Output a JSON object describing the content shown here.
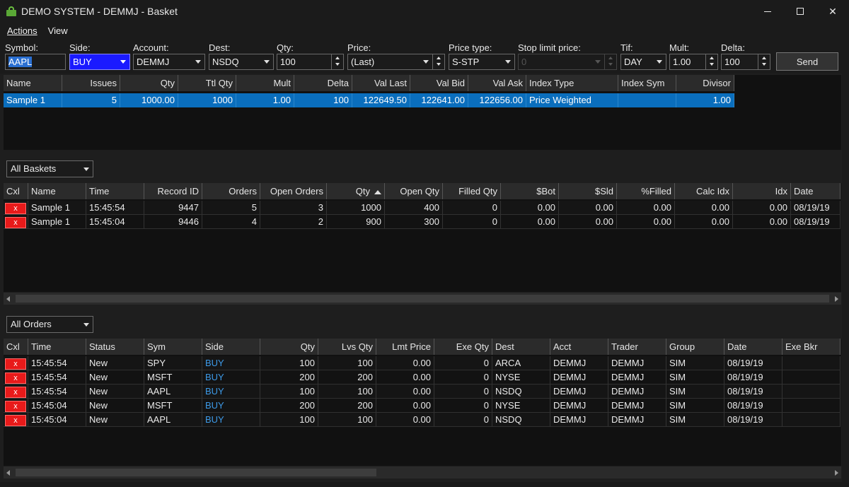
{
  "window": {
    "title": "DEMO SYSTEM - DEMMJ - Basket",
    "icon": "basket-icon",
    "minimize": "—",
    "maximize": "☐",
    "close": "✕"
  },
  "menu": {
    "actions": "Actions",
    "view": "View"
  },
  "entry": {
    "symbol": {
      "label": "Symbol:",
      "value": "AAPL"
    },
    "side": {
      "label": "Side:",
      "value": "BUY"
    },
    "account": {
      "label": "Account:",
      "value": "DEMMJ"
    },
    "dest": {
      "label": "Dest:",
      "value": "NSDQ"
    },
    "qty": {
      "label": "Qty:",
      "value": "100"
    },
    "price": {
      "label": "Price:",
      "value": "(Last)"
    },
    "price_type": {
      "label": "Price type:",
      "value": "S-STP"
    },
    "stop_limit": {
      "label": "Stop limit price:",
      "value": "0"
    },
    "tif": {
      "label": "Tif:",
      "value": "DAY"
    },
    "mult": {
      "label": "Mult:",
      "value": "1.00"
    },
    "delta": {
      "label": "Delta:",
      "value": "100"
    },
    "send": "Send"
  },
  "basket_grid": {
    "columns": [
      "Name",
      "Issues",
      "Qty",
      "Ttl Qty",
      "Mult",
      "Delta",
      "Val Last",
      "Val Bid",
      "Val Ask",
      "Index Type",
      "Index Sym",
      "Divisor"
    ],
    "rows": [
      [
        "Sample 1",
        "5",
        "1000.00",
        "1000",
        "1.00",
        "100",
        "122649.50",
        "122641.00",
        "122656.00",
        "Price Weighted",
        "",
        "1.00"
      ]
    ]
  },
  "records": {
    "filter": "All Baskets",
    "columns": [
      "Cxl",
      "Name",
      "Time",
      "Record ID",
      "Orders",
      "Open Orders",
      "Qty",
      "Open Qty",
      "Filled Qty",
      "$Bot",
      "$Sld",
      "%Filled",
      "Calc Idx",
      "Idx",
      "Date"
    ],
    "cancel_label": "x",
    "rows": [
      [
        "Sample 1",
        "15:45:54",
        "9447",
        "5",
        "3",
        "1000",
        "400",
        "0",
        "0.00",
        "0.00",
        "0.00",
        "0.00",
        "0.00",
        "08/19/19"
      ],
      [
        "Sample 1",
        "15:45:04",
        "9446",
        "4",
        "2",
        "900",
        "300",
        "0",
        "0.00",
        "0.00",
        "0.00",
        "0.00",
        "0.00",
        "08/19/19"
      ]
    ]
  },
  "orders": {
    "filter": "All Orders",
    "columns": [
      "Cxl",
      "Time",
      "Status",
      "Sym",
      "Side",
      "Qty",
      "Lvs Qty",
      "Lmt Price",
      "Exe Qty",
      "Dest",
      "Acct",
      "Trader",
      "Group",
      "Date",
      "Exe Bkr"
    ],
    "cancel_label": "x",
    "rows": [
      [
        "15:45:54",
        "New",
        "SPY",
        "BUY",
        "100",
        "100",
        "0.00",
        "0",
        "ARCA",
        "DEMMJ",
        "DEMMJ",
        "SIM",
        "08/19/19",
        ""
      ],
      [
        "15:45:54",
        "New",
        "MSFT",
        "BUY",
        "200",
        "200",
        "0.00",
        "0",
        "NYSE",
        "DEMMJ",
        "DEMMJ",
        "SIM",
        "08/19/19",
        ""
      ],
      [
        "15:45:54",
        "New",
        "AAPL",
        "BUY",
        "100",
        "100",
        "0.00",
        "0",
        "NSDQ",
        "DEMMJ",
        "DEMMJ",
        "SIM",
        "08/19/19",
        ""
      ],
      [
        "15:45:04",
        "New",
        "MSFT",
        "BUY",
        "200",
        "200",
        "0.00",
        "0",
        "NYSE",
        "DEMMJ",
        "DEMMJ",
        "SIM",
        "08/19/19",
        ""
      ],
      [
        "15:45:04",
        "New",
        "AAPL",
        "BUY",
        "100",
        "100",
        "0.00",
        "0",
        "NSDQ",
        "DEMMJ",
        "DEMMJ",
        "SIM",
        "08/19/19",
        ""
      ]
    ]
  },
  "colors": {
    "selection": "#0a6ebd",
    "cancel": "#e81a1a",
    "buy": "#3d9ae8",
    "side_field": "#1a1aff"
  }
}
